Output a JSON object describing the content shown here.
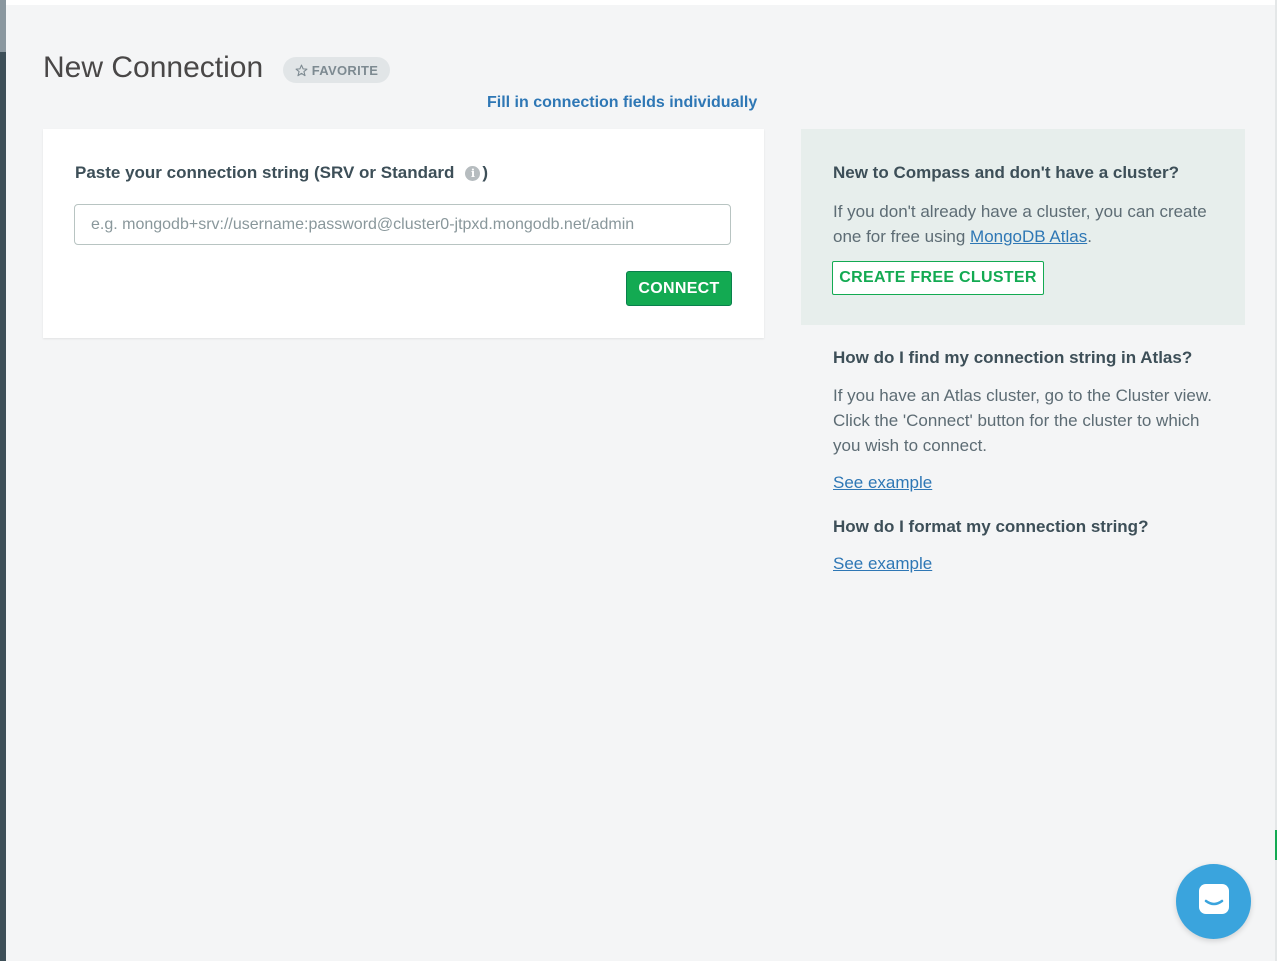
{
  "header": {
    "title": "New Connection",
    "favorite_label": "FAVORITE",
    "fill_fields_link": "Fill in connection fields individually"
  },
  "connection_card": {
    "label": "Paste your connection string (SRV or Standard",
    "label_close": ")",
    "info_icon": "info-icon",
    "input_value": "",
    "input_placeholder": "e.g. mongodb+srv://username:password@cluster0-jtpxd.mongodb.net/admin",
    "connect_button": "CONNECT"
  },
  "help": {
    "new_title": "New to Compass and don't have a cluster?",
    "new_text_before": "If you don't already have a cluster, you can create one for free using ",
    "atlas_link": "MongoDB Atlas",
    "new_text_after": ".",
    "create_cluster_button": "CREATE FREE CLUSTER",
    "find_title": "How do I find my connection string in Atlas?",
    "find_text": "If you have an Atlas cluster, go to the Cluster view. Click the 'Connect' button for the cluster to which you wish to connect.",
    "find_link": "See example",
    "format_title": "How do I format my connection string?",
    "format_link": "See example"
  },
  "chat_widget": {
    "icon": "chat-icon"
  },
  "colors": {
    "accent_green": "#13aa52",
    "link_blue": "#2e77b5",
    "chat_blue": "#3aa4dd",
    "help_box_bg": "#e7eeec"
  }
}
